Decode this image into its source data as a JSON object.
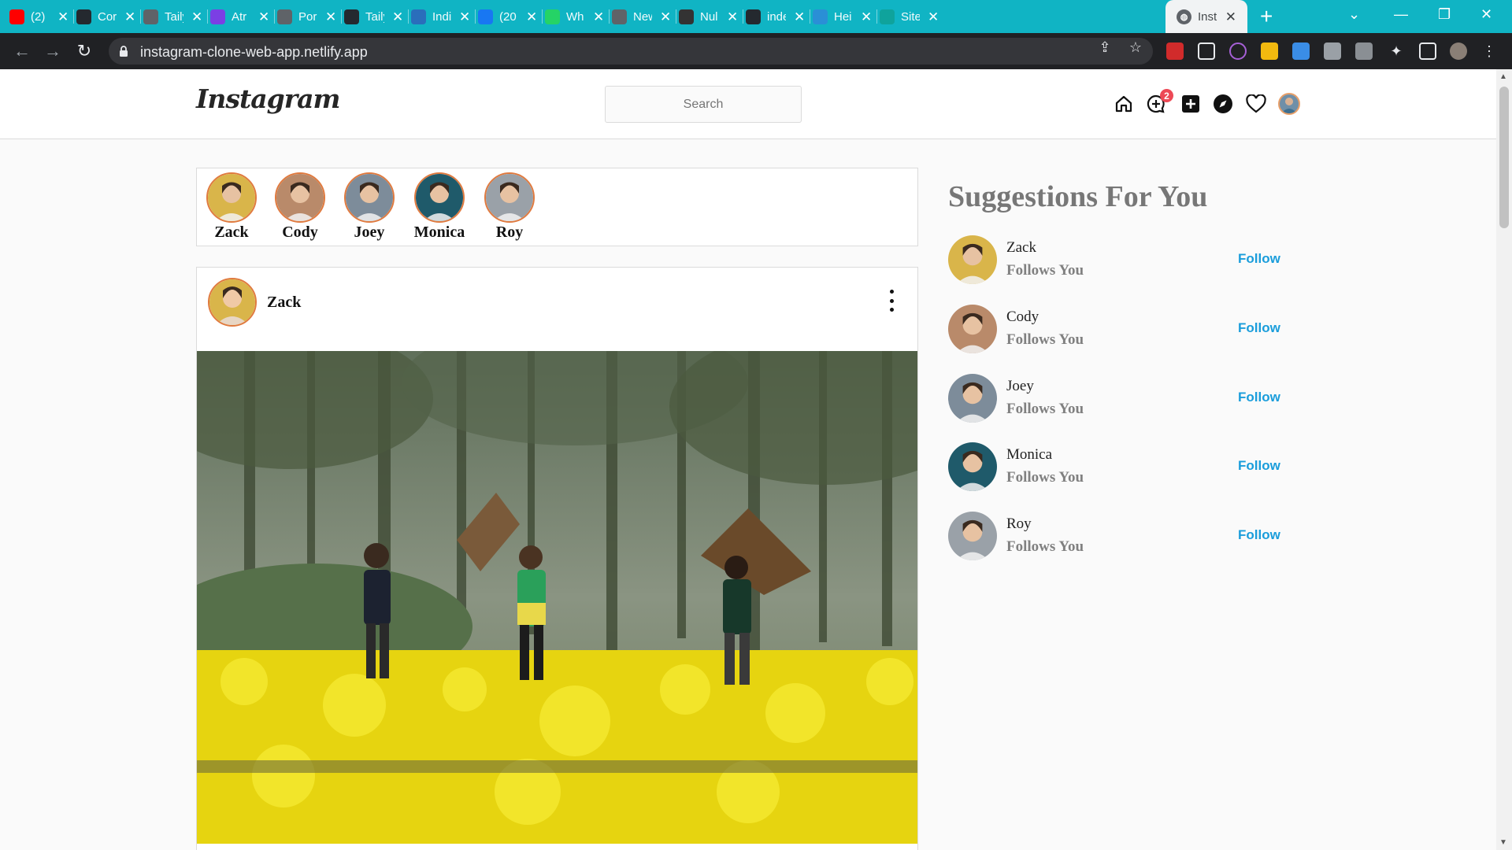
{
  "browser": {
    "tabs": [
      {
        "title": "(2)",
        "color": "#ff0000",
        "icon": "youtube-icon"
      },
      {
        "title": "Cor",
        "color": "#24292f",
        "icon": "github-icon"
      },
      {
        "title": "Taily",
        "color": "#5f6368",
        "icon": "globe-icon"
      },
      {
        "title": "Atr",
        "color": "#7b3fe4",
        "icon": "atr-icon"
      },
      {
        "title": "Por",
        "color": "#5f6368",
        "icon": "globe-icon"
      },
      {
        "title": "Taily",
        "color": "#24292f",
        "icon": "github-icon"
      },
      {
        "title": "Indi",
        "color": "#2a6ebb",
        "icon": "indi-icon"
      },
      {
        "title": "(20",
        "color": "#1877f2",
        "icon": "facebook-icon"
      },
      {
        "title": "Wh",
        "color": "#25d366",
        "icon": "whatsapp-icon"
      },
      {
        "title": "New",
        "color": "#5f6368",
        "icon": "globe-icon"
      },
      {
        "title": "Nul",
        "color": "#333333",
        "icon": "nul-icon"
      },
      {
        "title": "inde",
        "color": "#24292f",
        "icon": "github-icon"
      },
      {
        "title": "Hei",
        "color": "#2a8fd6",
        "icon": "hei-icon"
      },
      {
        "title": "Site",
        "color": "#0fa39c",
        "icon": "site-icon"
      }
    ],
    "active_tab": {
      "title": "Inst",
      "icon": "globe-icon"
    },
    "url": "instagram-clone-web-app.netlify.app"
  },
  "header": {
    "logo": "Instagram",
    "search_placeholder": "Search",
    "messages_badge": "2"
  },
  "stories": [
    {
      "name": "Zack",
      "avatar_color": "#d9b54a"
    },
    {
      "name": "Cody",
      "avatar_color": "#b98a6a"
    },
    {
      "name": "Joey",
      "avatar_color": "#7d8c9a"
    },
    {
      "name": "Monica",
      "avatar_color": "#1f5a6a"
    },
    {
      "name": "Roy",
      "avatar_color": "#9aa1a8"
    }
  ],
  "post": {
    "author": "Zack"
  },
  "suggestions": {
    "title": "Suggestions For You",
    "items": [
      {
        "name": "Zack",
        "subtitle": "Follows You",
        "action": "Follow",
        "avatar_color": "#d9b54a"
      },
      {
        "name": "Cody",
        "subtitle": "Follows You",
        "action": "Follow",
        "avatar_color": "#b98a6a"
      },
      {
        "name": "Joey",
        "subtitle": "Follows You",
        "action": "Follow",
        "avatar_color": "#7d8c9a"
      },
      {
        "name": "Monica",
        "subtitle": "Follows You",
        "action": "Follow",
        "avatar_color": "#1f5a6a"
      },
      {
        "name": "Roy",
        "subtitle": "Follows You",
        "action": "Follow",
        "avatar_color": "#9aa1a8"
      }
    ]
  },
  "colors": {
    "accent_follow": "#1a9ddb",
    "story_ring": "#e07a3f",
    "tabstrip": "#10b4c4"
  }
}
